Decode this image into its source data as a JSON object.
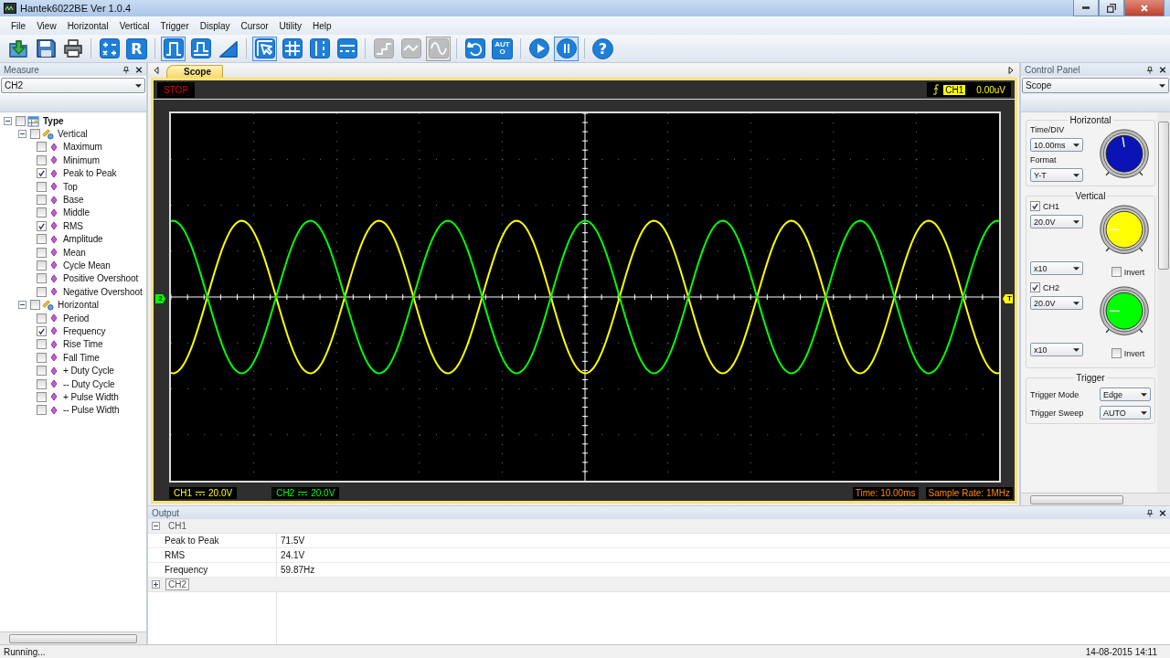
{
  "window": {
    "title": "Hantek6022BE Ver 1.0.4"
  },
  "menu": [
    "File",
    "View",
    "Horizontal",
    "Vertical",
    "Trigger",
    "Display",
    "Cursor",
    "Utility",
    "Help"
  ],
  "toolbar": [
    [
      {
        "kind": "import",
        "selected": false,
        "disabled": false
      },
      {
        "kind": "save",
        "selected": false,
        "disabled": false
      },
      {
        "kind": "print",
        "selected": false,
        "disabled": false
      }
    ],
    [
      {
        "kind": "math",
        "selected": false,
        "disabled": false
      },
      {
        "kind": "ref",
        "label": "R",
        "selected": false,
        "disabled": false
      }
    ],
    [
      {
        "kind": "square-pulse",
        "selected": true,
        "disabled": false
      },
      {
        "kind": "pulse-step",
        "selected": false,
        "disabled": false
      },
      {
        "kind": "ramp",
        "selected": false,
        "disabled": false
      }
    ],
    [
      {
        "kind": "cursor-pointer",
        "selected": true,
        "disabled": false
      },
      {
        "kind": "grid",
        "selected": false,
        "disabled": false
      },
      {
        "kind": "vertical-cursor",
        "selected": false,
        "disabled": false
      },
      {
        "kind": "horizontal-cursor",
        "selected": false,
        "disabled": false
      }
    ],
    [
      {
        "kind": "step",
        "selected": false,
        "disabled": true
      },
      {
        "kind": "wave",
        "selected": false,
        "disabled": true
      },
      {
        "kind": "sine",
        "selected": true,
        "disabled": true
      }
    ],
    [
      {
        "kind": "refresh",
        "selected": false,
        "disabled": false
      },
      {
        "kind": "auto",
        "label": "AUTO",
        "selected": false,
        "disabled": false
      }
    ],
    [
      {
        "kind": "play",
        "selected": false,
        "disabled": false
      },
      {
        "kind": "pause",
        "selected": true,
        "disabled": false
      }
    ],
    [
      {
        "kind": "help",
        "label": "?",
        "selected": false,
        "disabled": false
      }
    ]
  ],
  "measure_panel": {
    "title": "Measure",
    "channel": "CH2",
    "tree": {
      "label": "Type",
      "checked": false,
      "expanded": true,
      "children": [
        {
          "label": "Vertical",
          "checked": false,
          "expanded": true,
          "children": [
            {
              "label": "Maximum",
              "checked": false
            },
            {
              "label": "Minimum",
              "checked": false
            },
            {
              "label": "Peak to Peak",
              "checked": true
            },
            {
              "label": "Top",
              "checked": false
            },
            {
              "label": "Base",
              "checked": false
            },
            {
              "label": "Middle",
              "checked": false
            },
            {
              "label": "RMS",
              "checked": true
            },
            {
              "label": "Amplitude",
              "checked": false
            },
            {
              "label": "Mean",
              "checked": false
            },
            {
              "label": "Cycle Mean",
              "checked": false
            },
            {
              "label": "Positive Overshoot",
              "checked": false
            },
            {
              "label": "Negative Overshoot",
              "checked": false
            }
          ]
        },
        {
          "label": "Horizontal",
          "checked": false,
          "expanded": true,
          "children": [
            {
              "label": "Period",
              "checked": false
            },
            {
              "label": "Frequency",
              "checked": true
            },
            {
              "label": "Rise Time",
              "checked": false
            },
            {
              "label": "Fall Time",
              "checked": false
            },
            {
              "label": "+ Duty Cycle",
              "checked": false
            },
            {
              "label": "-- Duty Cycle",
              "checked": false
            },
            {
              "label": "+ Pulse Width",
              "checked": false
            },
            {
              "label": "-- Pulse Width",
              "checked": false
            }
          ]
        }
      ]
    }
  },
  "scope": {
    "tab": "Scope",
    "run_state": "STOP",
    "trigger_channel": "CH1",
    "trigger_level": "0.00uV",
    "ch2_marker": "2",
    "trigger_marker": "T",
    "channels": [
      {
        "name": "CH1",
        "scale": "20.0V",
        "color": "#ffff00"
      },
      {
        "name": "CH2",
        "scale": "20.0V",
        "color": "#00ff00"
      }
    ],
    "time": "Time: 10.00ms",
    "sample_rate": "Sample Rate: 1MHz"
  },
  "control_panel": {
    "title": "Control Panel",
    "mode": "Scope",
    "horizontal": {
      "title": "Horizontal",
      "time_label": "Time/DIV",
      "time_value": "10.00ms",
      "format_label": "Format",
      "format_value": "Y-T"
    },
    "vertical": {
      "title": "Vertical",
      "channels": [
        {
          "name": "CH1",
          "checked": true,
          "scale": "20.0V",
          "probe": "x10",
          "invert_label": "Invert",
          "invert": false,
          "color": "#ffff00"
        },
        {
          "name": "CH2",
          "checked": true,
          "scale": "20.0V",
          "probe": "x10",
          "invert_label": "Invert",
          "invert": false,
          "color": "#00ff00"
        }
      ]
    },
    "trigger": {
      "title": "Trigger",
      "mode_label": "Trigger Mode",
      "mode": "Edge",
      "sweep_label": "Trigger Sweep",
      "sweep": "AUTO"
    }
  },
  "output": {
    "title": "Output",
    "groups": [
      {
        "name": "CH1",
        "expanded": true,
        "selected": false,
        "rows": [
          {
            "name": "Peak to Peak",
            "value": "71.5V"
          },
          {
            "name": "RMS",
            "value": "24.1V"
          },
          {
            "name": "Frequency",
            "value": "59.87Hz"
          }
        ]
      },
      {
        "name": "CH2",
        "expanded": false,
        "selected": true
      }
    ]
  },
  "status_bar": {
    "message": "Running...",
    "datetime": "14-08-2015 14:11"
  }
}
